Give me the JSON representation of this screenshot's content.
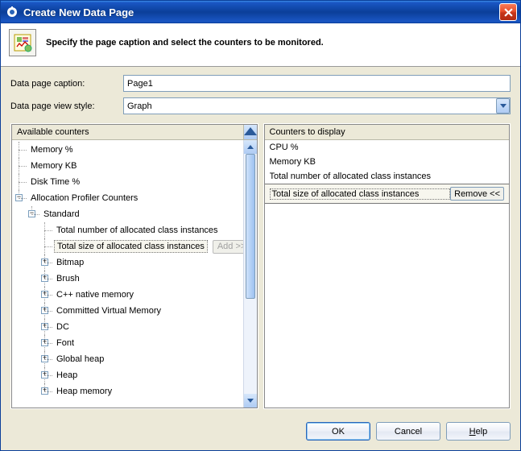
{
  "titlebar": {
    "title": "Create New Data Page"
  },
  "header": {
    "text": "Specify the page caption and select the counters to be monitored."
  },
  "form": {
    "caption_label": "Data page caption:",
    "caption_value": "Page1",
    "style_label": "Data page view style:",
    "style_value": "Graph"
  },
  "available": {
    "header": "Available counters",
    "top_items": [
      "Memory %",
      "Memory KB",
      "Disk Time %"
    ],
    "profiler_group": "Allocation Profiler Counters",
    "standard_group": "Standard",
    "standard_items_top": [
      "Total number of allocated class instances"
    ],
    "selected_item": "Total size of allocated class instances",
    "add_label": "Add >>",
    "standard_items_rest": [
      "Bitmap",
      "Brush",
      "C++ native memory",
      "Committed Virtual Memory",
      "DC",
      "Font",
      "Global heap",
      "Heap",
      "Heap memory"
    ]
  },
  "display": {
    "header": "Counters to display",
    "items": [
      "CPU %",
      "Memory KB",
      "Total number of allocated class instances"
    ],
    "selected": "Total size of allocated class instances",
    "remove_label": "Remove <<"
  },
  "buttons": {
    "ok": "OK",
    "cancel": "Cancel",
    "help": "Help"
  }
}
